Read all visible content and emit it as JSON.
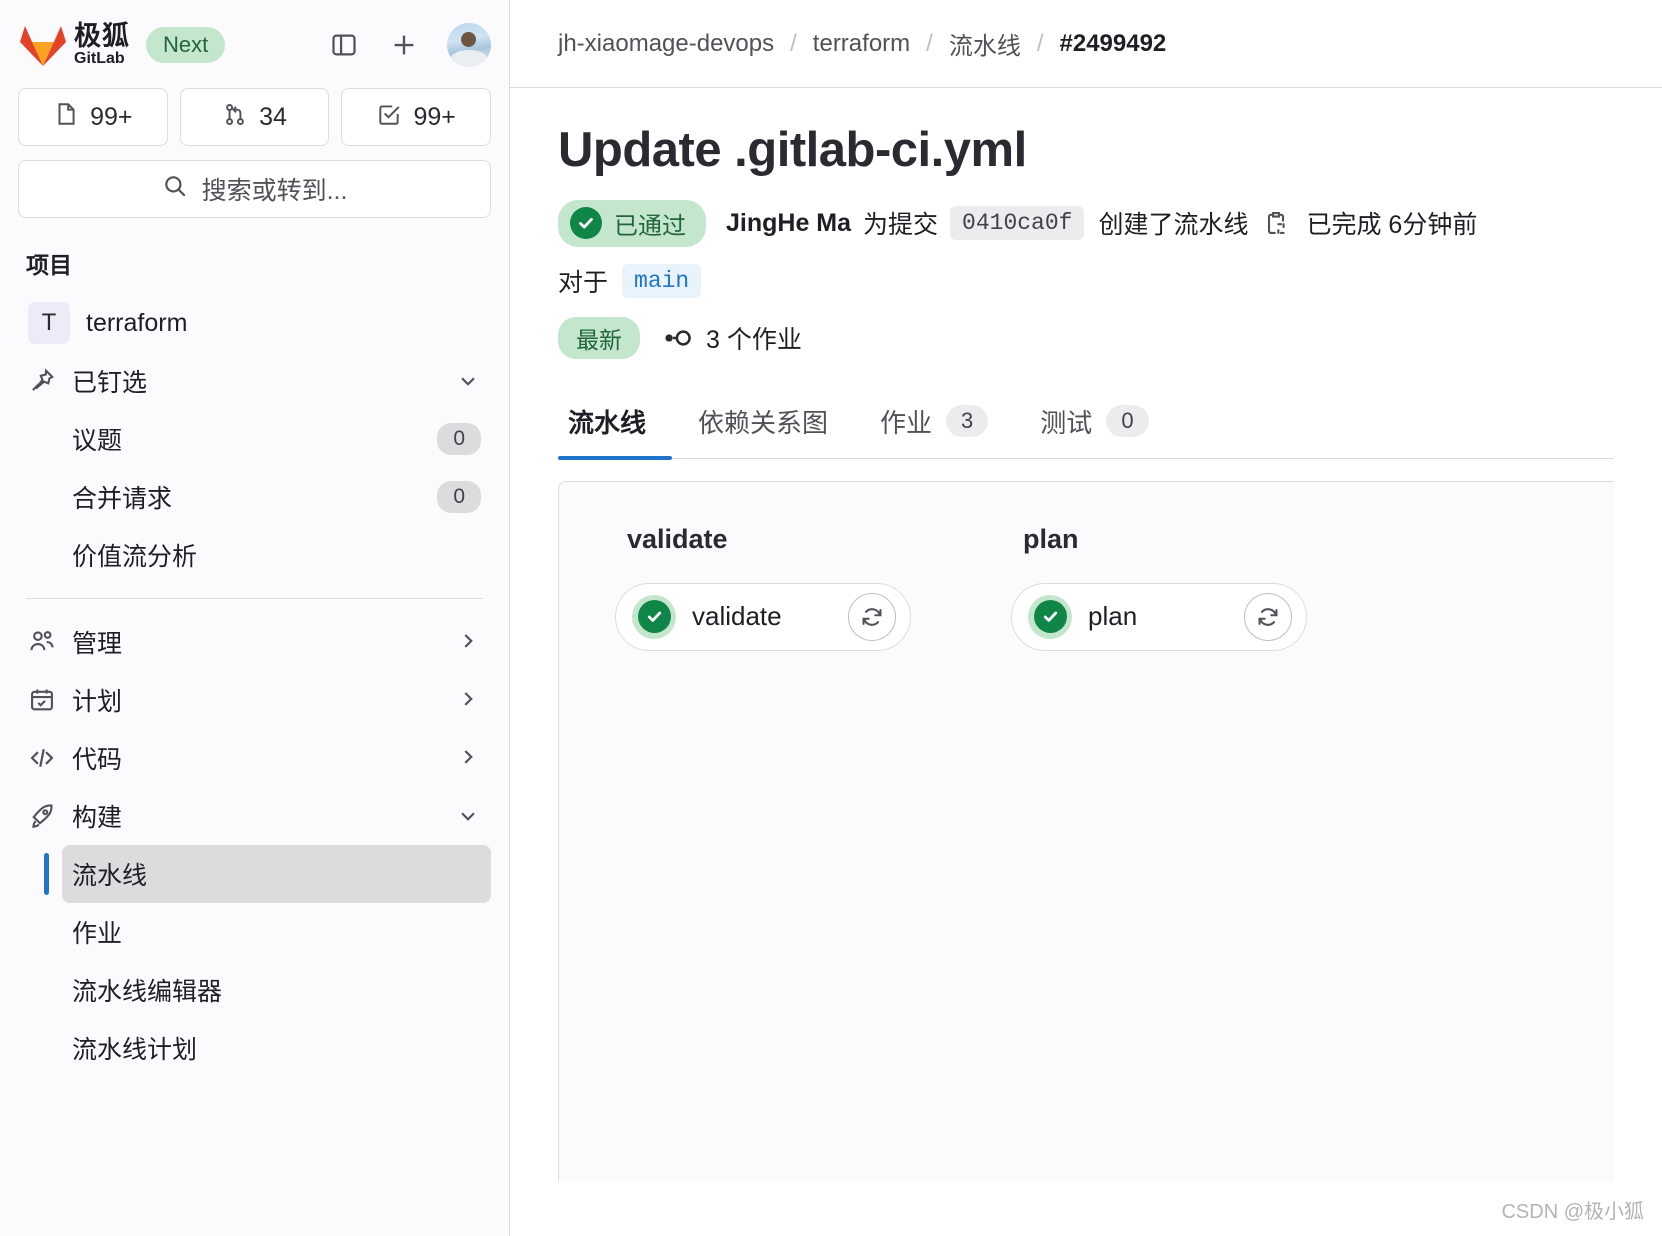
{
  "sidebar": {
    "brand": {
      "cn": "极狐",
      "en": "GitLab",
      "badge": "Next",
      "logo_icon": "gitlab-fox-logo",
      "toggle_icon": "sidebar-toggle-icon",
      "plus_icon": "plus-icon",
      "avatar_icon": "user-avatar"
    },
    "counts": [
      {
        "icon": "issues-icon",
        "value": "99+"
      },
      {
        "icon": "merge-request-icon",
        "value": "34"
      },
      {
        "icon": "todo-check-icon",
        "value": "99+"
      }
    ],
    "search": {
      "placeholder": "搜索或转到...",
      "icon": "search-icon"
    },
    "section_title": "项目",
    "project": {
      "initial": "T",
      "name": "terraform"
    },
    "pinned": {
      "label": "已钉选",
      "icon": "pin-icon",
      "chevron": "chevron-down-icon"
    },
    "pinned_items": [
      {
        "label": "议题",
        "count": "0"
      },
      {
        "label": "合并请求",
        "count": "0"
      },
      {
        "label": "价值流分析",
        "count": ""
      }
    ],
    "groups": [
      {
        "label": "管理",
        "icon": "users-icon",
        "chevron": "chevron-right-icon"
      },
      {
        "label": "计划",
        "icon": "calendar-icon",
        "chevron": "chevron-right-icon"
      },
      {
        "label": "代码",
        "icon": "code-icon",
        "chevron": "chevron-right-icon"
      },
      {
        "label": "构建",
        "icon": "rocket-icon",
        "chevron": "chevron-down-icon"
      }
    ],
    "build_items": [
      {
        "label": "流水线",
        "active": true
      },
      {
        "label": "作业",
        "active": false
      },
      {
        "label": "流水线编辑器",
        "active": false
      },
      {
        "label": "流水线计划",
        "active": false
      }
    ]
  },
  "breadcrumb": {
    "group": "jh-xiaomage-devops",
    "project": "terraform",
    "section": "流水线",
    "current": "#2499492",
    "separator": "/"
  },
  "page": {
    "title": "Update .gitlab-ci.yml",
    "status_badge": "已通过",
    "status_icon": "check-circle-icon",
    "author": "JingHe Ma",
    "text_for_commit": "为提交",
    "commit_sha": "0410ca0f",
    "text_created_pipeline": "创建了流水线",
    "copy_icon": "copy-to-clipboard-icon",
    "finished_text": "已完成 6分钟前",
    "branch_prefix": "对于",
    "branch": "main",
    "latest_badge": "最新",
    "jobs_icon": "pipeline-icon",
    "jobs_text": "3 个作业"
  },
  "tabs": [
    {
      "label": "流水线",
      "count": "",
      "active": true
    },
    {
      "label": "依赖关系图",
      "count": "",
      "active": false
    },
    {
      "label": "作业",
      "count": "3",
      "active": false
    },
    {
      "label": "测试",
      "count": "0",
      "active": false
    }
  ],
  "pipeline_graph": {
    "stages": [
      {
        "name": "validate",
        "jobs": [
          {
            "name": "validate",
            "status": "success",
            "status_icon": "check-circle-icon",
            "retry_icon": "retry-icon"
          }
        ]
      },
      {
        "name": "plan",
        "jobs": [
          {
            "name": "plan",
            "status": "success",
            "status_icon": "check-circle-icon",
            "retry_icon": "retry-icon"
          }
        ]
      }
    ]
  },
  "watermark": "CSDN @极小狐",
  "colors": {
    "accent": "#1f75cb",
    "success": "#108548",
    "success_bg": "#c3e6cd",
    "sidebar_bg": "#fbfafd",
    "border": "#dcdcde"
  }
}
